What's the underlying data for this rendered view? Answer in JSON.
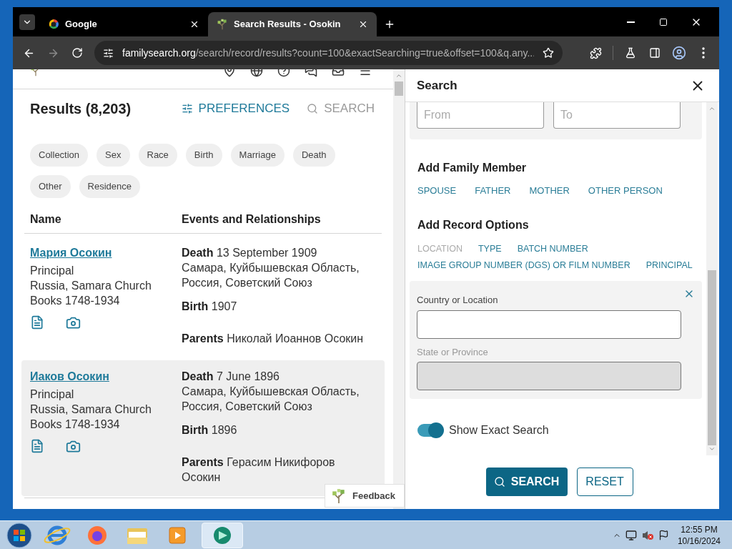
{
  "browser": {
    "tabs": [
      {
        "title": "Google",
        "selected": false,
        "kind": "google"
      },
      {
        "title": "Search Results - Osokin",
        "selected": true,
        "kind": "tree"
      }
    ],
    "address": {
      "host": "familysearch.org",
      "path": "/search/record/results?count=100&exactSearching=true&offset=100&q.any..."
    }
  },
  "results": {
    "title": "Results (8,203)",
    "preferences": "PREFERENCES",
    "search": "SEARCH",
    "filters": [
      "Collection",
      "Sex",
      "Race",
      "Birth",
      "Marriage",
      "Death",
      "Other",
      "Residence"
    ],
    "columns": [
      "Name",
      "Events and Relationships"
    ],
    "rows": [
      {
        "name": "Мария Осокин",
        "role": "Principal",
        "collection": "Russia, Samara Church Books 1748-1934",
        "hovered": false,
        "events": [
          {
            "label": "Death",
            "value": "13 September 1909",
            "place": "Самара, Куйбышевская Область, Россия, Советский Союз"
          },
          {
            "label": "Birth",
            "value": "1907"
          },
          {
            "label": "Parents",
            "value": "Николай Иоаннов Осокин"
          }
        ]
      },
      {
        "name": "Иаков Осокин",
        "role": "Principal",
        "collection": "Russia, Samara Church Books 1748-1934",
        "hovered": true,
        "events": [
          {
            "label": "Death",
            "value": "7 June 1896",
            "place": "Самара, Куйбышевская Область, Россия, Советский Союз"
          },
          {
            "label": "Birth",
            "value": "1896"
          },
          {
            "label": "Parents",
            "value": "Герасим Никифоров Осокин"
          }
        ]
      }
    ]
  },
  "feedback": "Feedback",
  "search_panel": {
    "title": "Search",
    "date_fields": [
      {
        "placeholder": "From"
      },
      {
        "placeholder": "To"
      }
    ],
    "family": {
      "heading": "Add Family Member",
      "links": [
        "SPOUSE",
        "FATHER",
        "MOTHER",
        "OTHER PERSON"
      ]
    },
    "record_options": {
      "heading": "Add Record Options",
      "links": [
        {
          "label": "LOCATION",
          "disabled": true
        },
        {
          "label": "TYPE",
          "disabled": false
        },
        {
          "label": "BATCH NUMBER",
          "disabled": false
        },
        {
          "label": "IMAGE GROUP NUMBER (DGS) OR FILM NUMBER",
          "disabled": false
        },
        {
          "label": "PRINCIPAL",
          "disabled": false
        }
      ]
    },
    "location_fields": [
      {
        "label": "Country or Location",
        "disabled": false
      },
      {
        "label": "State or Province",
        "disabled": true
      }
    ],
    "exact_search": {
      "label": "Show Exact Search",
      "on": true
    },
    "search_button": "SEARCH",
    "reset_button": "RESET"
  },
  "taskbar": {
    "time": "12:55 PM",
    "date": "10/16/2024"
  }
}
